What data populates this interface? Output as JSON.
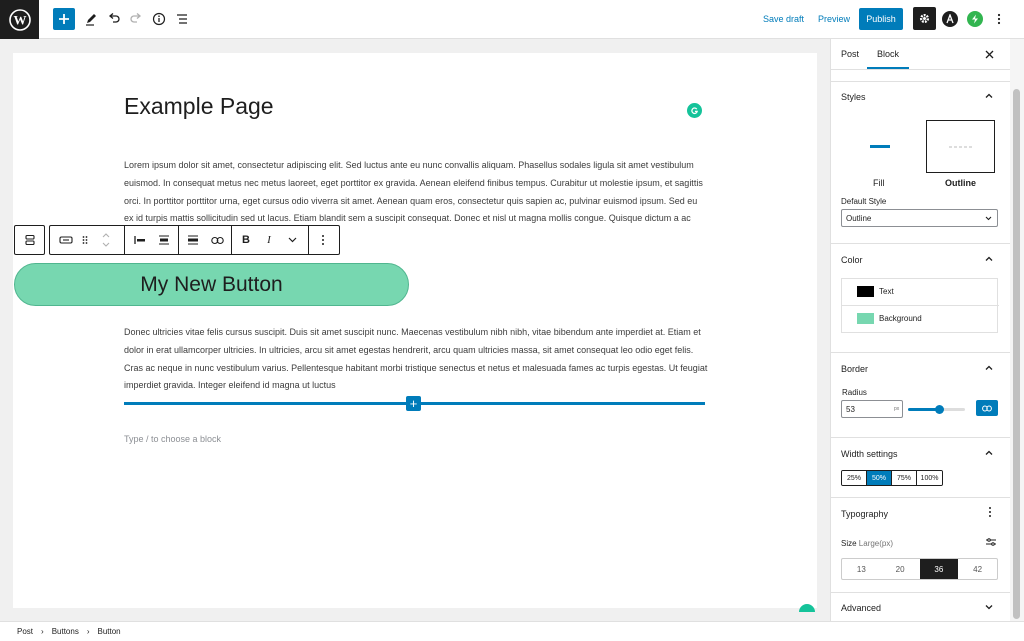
{
  "topbar": {
    "save_draft": "Save draft",
    "preview": "Preview",
    "publish": "Publish"
  },
  "editor": {
    "title": "Example Page",
    "paragraph1": "Lorem ipsum dolor sit amet, consectetur adipiscing elit. Sed luctus ante eu nunc convallis aliquam. Phasellus sodales ligula sit amet vestibulum euismod. In consequat metus nec metus laoreet, eget porttitor ex gravida. Aenean eleifend finibus tempus. Curabitur ut molestie ipsum, et sagittis orci. In porttitor porttitor urna, eget cursus odio viverra sit amet. Aenean quam eros, consectetur quis sapien ac, pulvinar euismod ipsum. Sed eu ex id turpis mattis sollicitudin sed ut lacus. Etiam blandit sem a suscipit consequat. Donec et nisl ut magna mollis congue. Quisque dictum a ac ipsum. Maecenas vestibulum a velit eu mattis.",
    "button_text": "My New Button",
    "paragraph2": "Donec ultricies vitae felis cursus suscipit. Duis sit amet suscipit nunc. Maecenas vestibulum nibh nibh, vitae bibendum ante imperdiet at. Etiam et dolor in erat ullamcorper ultricies. In ultricies, arcu sit amet egestas hendrerit, arcu quam ultricies massa, sit amet consequat leo odio eget felis. Cras ac neque in nunc vestibulum varius. Pellentesque habitant morbi tristique senectus et netus et malesuada fames ac turpis egestas. Ut feugiat imperdiet gravida. Integer eleifend id magna ut luctus",
    "placeholder": "Type / to choose a block"
  },
  "sidebar": {
    "tabs": [
      "Post",
      "Block"
    ],
    "styles": {
      "heading": "Styles",
      "options": [
        "Fill",
        "Outline"
      ],
      "default_style_label": "Default Style",
      "default_style_value": "Outline"
    },
    "color": {
      "heading": "Color",
      "items": [
        {
          "label": "Text",
          "color": "#000000"
        },
        {
          "label": "Background",
          "color": "#77d7b0"
        }
      ]
    },
    "border": {
      "heading": "Border",
      "radius_label": "Radius",
      "radius_value": "53",
      "radius_unit": "px",
      "slider_fraction": 0.55
    },
    "width": {
      "heading": "Width settings",
      "options": [
        "25%",
        "50%",
        "75%",
        "100%"
      ],
      "selected": "50%"
    },
    "typography": {
      "heading": "Typography",
      "size_label": "Size",
      "size_hint": "Large(px)",
      "sizes": [
        "13",
        "20",
        "36",
        "42"
      ],
      "selected": "36"
    },
    "advanced": {
      "heading": "Advanced"
    }
  },
  "breadcrumb": [
    "Post",
    "Buttons",
    "Button"
  ],
  "colors": {
    "accent": "#007cba",
    "button_bg": "#77d7b0",
    "dark": "#1e1e1e",
    "grammarly": "#15c39a"
  }
}
